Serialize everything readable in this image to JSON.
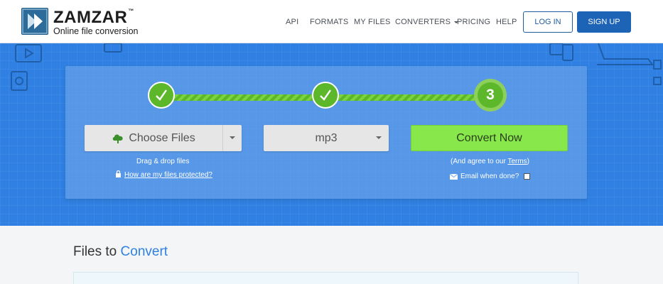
{
  "brand": {
    "name": "ZAMZAR",
    "trademark": "™",
    "tagline": "Online file conversion"
  },
  "nav": {
    "items": [
      {
        "label": "API"
      },
      {
        "label": "FORMATS"
      },
      {
        "label": "MY FILES"
      },
      {
        "label": "CONVERTERS",
        "has_dropdown": true
      },
      {
        "label": "PRICING"
      },
      {
        "label": "HELP"
      }
    ],
    "login_label": "LOG IN",
    "signup_label": "SIGN UP"
  },
  "steps": {
    "step1_state": "done",
    "step2_state": "done",
    "step3_label": "3",
    "check_icon": "check-icon"
  },
  "upload": {
    "choose_label": "Choose Files",
    "drag_drop_text": "Drag & drop files",
    "protected_link": "How are my files protected?"
  },
  "format": {
    "selected": "mp3"
  },
  "convert": {
    "button_label": "Convert Now",
    "agree_prefix": "(And agree to our ",
    "terms_link": "Terms",
    "agree_suffix": ")",
    "email_label": "Email when done?",
    "email_checked": false
  },
  "files_section": {
    "title_part1": "Files to ",
    "title_part2": "Convert"
  },
  "colors": {
    "hero_blue": "#2f80e2",
    "step_green": "#5cb82a",
    "convert_green": "#88e84b",
    "nav_button_blue": "#1d64b7"
  }
}
